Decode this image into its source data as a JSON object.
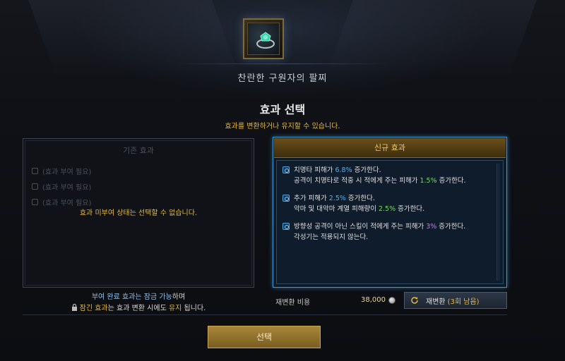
{
  "item": {
    "name": "찬란한 구원자의 팔찌",
    "icon": "bracelet-icon"
  },
  "dialog": {
    "title": "효과 선택",
    "subtitle": "효과를 변환하거나 유지할 수 있습니다."
  },
  "old_panel": {
    "header": "기존 효과",
    "rows": [
      "(효과 부여 필요)",
      "(효과 부여 필요)",
      "(효과 부여 필요)"
    ],
    "warning": "효과 미부여 상태는 선택할 수 없습니다.",
    "note1_hl": "부여 완료 효과는 잠금 가능",
    "note1_rest": "하며",
    "note2_hl": "잠긴 효과",
    "note2_mid": "는 효과 변환 시에도 ",
    "note2_hl2": "유지",
    "note2_end": " 됩니다."
  },
  "new_panel": {
    "header": "신규 효과",
    "effects": [
      {
        "l1_a": "치명타 피해가 ",
        "l1_v": "6.8%",
        "l1_b": " 증가한다.",
        "l2_a": "공격이 치명타로 적중 시 적에게 주는 피해가 ",
        "l2_v": "1.5%",
        "l2_b": " 증가한다."
      },
      {
        "l1_a": "추가 피해가 ",
        "l1_v": "2.5%",
        "l1_b": " 증가한다.",
        "l2_a": "악마 및 대악마 계열 피해량이 ",
        "l2_v": "2.5%",
        "l2_b": " 증가한다."
      },
      {
        "l1_a": "방향성 공격이 아닌 스킬이 적에게 주는 피해가 ",
        "l1_v": "3%",
        "l1_b": " 증가한다.",
        "l2": "각성기는 적용되지 않는다."
      }
    ]
  },
  "cost": {
    "label": "재변환 비용",
    "value": "38,000"
  },
  "reroll": {
    "label": "재변환",
    "count": "(3회 남음)"
  },
  "select_button": "선택",
  "colors": {
    "gold": "#e5b93a",
    "blue": "#4fb6f2",
    "green": "#7bd46a",
    "purple": "#c77ae8"
  }
}
